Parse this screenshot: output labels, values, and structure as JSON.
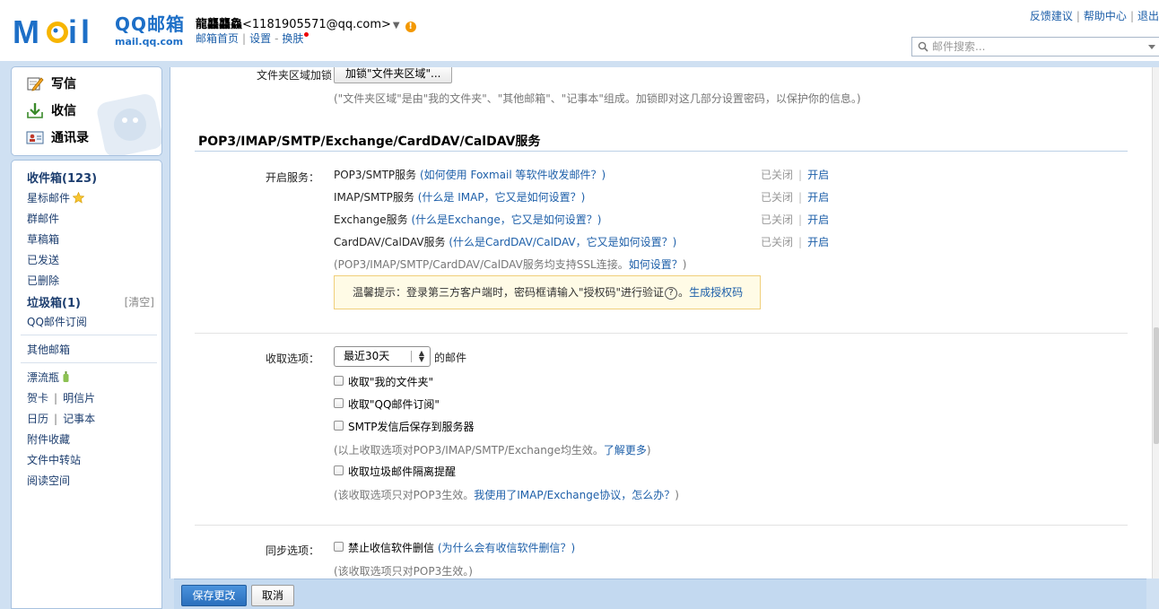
{
  "header": {
    "logo_cn": "QQ邮箱",
    "logo_url": "mail.qq.com",
    "user_nick": "龍龘龘鱻",
    "user_email": "<1181905571@qq.com>",
    "home_link": "邮箱首页",
    "settings_link": "设置",
    "skin_link": "换肤",
    "top_links": [
      "反馈建议",
      "帮助中心",
      "退出"
    ],
    "search_placeholder": "邮件搜索..."
  },
  "left": {
    "compose": "写信",
    "receive": "收信",
    "contacts": "通讯录",
    "nav": {
      "inbox": "收件箱(123)",
      "starred": "星标邮件",
      "group": "群邮件",
      "drafts": "草稿箱",
      "sent": "已发送",
      "deleted": "已删除",
      "spam": "垃圾箱(1)",
      "spam_clear": "[清空]",
      "subscription": "QQ邮件订阅",
      "other_mailbox": "其他邮箱",
      "bottle": "漂流瓶",
      "card": "贺卡",
      "postcard": "明信片",
      "calendar": "日历",
      "notes": "记事本",
      "attachments": "附件收藏",
      "transfer": "文件中转站",
      "reading": "阅读空间"
    }
  },
  "content": {
    "folder_lock_label": "文件夹区域加锁：",
    "folder_lock_button": "加锁\"文件夹区域\"...",
    "folder_lock_desc": "(\"文件夹区域\"是由\"我的文件夹\"、\"其他邮箱\"、\"记事本\"组成。加锁即对这几部分设置密码，以保护你的信息。)",
    "section_title": "POP3/IMAP/SMTP/Exchange/CardDAV/CalDAV服务",
    "services_label": "开启服务：",
    "services": [
      {
        "name": "POP3/SMTP服务",
        "help": "(如何使用 Foxmail 等软件收发邮件？)",
        "status_off": "已关闭",
        "status_on": "开启"
      },
      {
        "name": "IMAP/SMTP服务",
        "help": "(什么是 IMAP，它又是如何设置？)",
        "status_off": "已关闭",
        "status_on": "开启"
      },
      {
        "name": "Exchange服务",
        "help": "(什么是Exchange，它又是如何设置？)",
        "status_off": "已关闭",
        "status_on": "开启"
      },
      {
        "name": "CardDAV/CalDAV服务",
        "help": "(什么是CardDAV/CalDAV，它又是如何设置？)",
        "status_off": "已关闭",
        "status_on": "开启"
      }
    ],
    "ssl_note": "(POP3/IMAP/SMTP/CardDAV/CalDAV服务均支持SSL连接。",
    "ssl_link": "如何设置？",
    "ssl_end": ")",
    "tip_text": "温馨提示：登录第三方客户端时，密码框请输入\"授权码\"进行验证",
    "tip_help": "?",
    "tip_period": "。",
    "tip_link": "生成授权码",
    "fetch_label": "收取选项：",
    "fetch_range": "最近30天",
    "fetch_suffix": "的邮件",
    "fetch_options": [
      "收取\"我的文件夹\"",
      "收取\"QQ邮件订阅\"",
      "SMTP发信后保存到服务器"
    ],
    "fetch_note": "(以上收取选项对POP3/IMAP/SMTP/Exchange均生效。",
    "fetch_note_link": "了解更多",
    "fetch_note_end": ")",
    "spam_option": "收取垃圾邮件隔离提醒",
    "spam_note": "(该收取选项只对POP3生效。",
    "spam_note_link": "我使用了IMAP/Exchange协议，怎么办？",
    "spam_note_end": ")",
    "sync_label": "同步选项：",
    "sync_option": "禁止收信软件删信",
    "sync_help": "(为什么会有收信软件删信？)",
    "sync_note": "(该收取选项只对POP3生效。)"
  },
  "footer": {
    "save": "保存更改",
    "cancel": "取消"
  }
}
